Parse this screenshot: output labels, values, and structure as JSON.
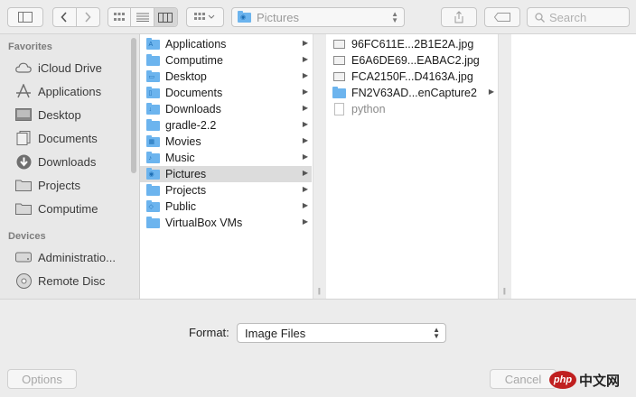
{
  "toolbar": {
    "path_label": "Pictures",
    "search_placeholder": "Search"
  },
  "sidebar": {
    "favorites_header": "Favorites",
    "favorites": [
      {
        "label": "iCloud Drive",
        "icon": "cloud-icon"
      },
      {
        "label": "Applications",
        "icon": "applications-icon"
      },
      {
        "label": "Desktop",
        "icon": "desktop-icon"
      },
      {
        "label": "Documents",
        "icon": "documents-icon"
      },
      {
        "label": "Downloads",
        "icon": "downloads-icon"
      },
      {
        "label": "Projects",
        "icon": "folder-icon"
      },
      {
        "label": "Computime",
        "icon": "folder-icon"
      }
    ],
    "devices_header": "Devices",
    "devices": [
      {
        "label": "Administratio...",
        "icon": "disk-icon"
      },
      {
        "label": "Remote Disc",
        "icon": "remote-disc-icon"
      }
    ]
  },
  "column1": {
    "items": [
      {
        "label": "Applications",
        "glyph": "A"
      },
      {
        "label": "Computime",
        "glyph": ""
      },
      {
        "label": "Desktop",
        "glyph": "▭"
      },
      {
        "label": "Documents",
        "glyph": "▯"
      },
      {
        "label": "Downloads",
        "glyph": "↓"
      },
      {
        "label": "gradle-2.2",
        "glyph": ""
      },
      {
        "label": "Movies",
        "glyph": "▦"
      },
      {
        "label": "Music",
        "glyph": "♪"
      },
      {
        "label": "Pictures",
        "glyph": "◉"
      },
      {
        "label": "Projects",
        "glyph": ""
      },
      {
        "label": "Public",
        "glyph": "◇"
      },
      {
        "label": "VirtualBox VMs",
        "glyph": ""
      }
    ],
    "selected_index": 8
  },
  "column2": {
    "items": [
      {
        "label": "96FC611E...2B1E2A.jpg",
        "type": "image"
      },
      {
        "label": "E6A6DE69...EABAC2.jpg",
        "type": "image"
      },
      {
        "label": "FCA2150F...D4163A.jpg",
        "type": "image"
      },
      {
        "label": "FN2V63AD...enCapture2",
        "type": "folder"
      },
      {
        "label": "python",
        "type": "document"
      }
    ]
  },
  "bottom": {
    "format_label": "Format:",
    "format_value": "Image Files"
  },
  "footer": {
    "options_label": "Options",
    "cancel_label": "Cancel",
    "watermark_text": "中文网",
    "watermark_logo": "php"
  }
}
